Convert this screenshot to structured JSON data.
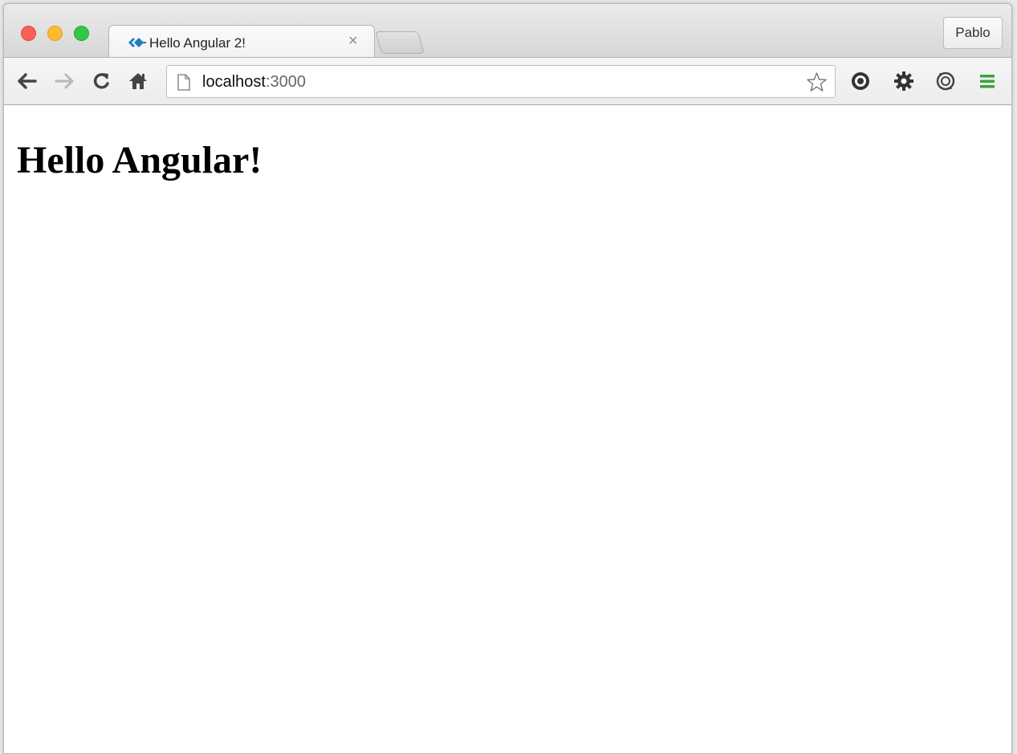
{
  "window": {
    "controls": [
      "close",
      "minimize",
      "zoom"
    ]
  },
  "tab": {
    "title": "Hello Angular 2!",
    "favicon": "angular-icon",
    "close_glyph": "×"
  },
  "profile": {
    "name": "Pablo"
  },
  "toolbar": {
    "icons": [
      "back-arrow-icon",
      "forward-arrow-icon",
      "reload-icon",
      "home-icon",
      "bookmark-star-icon",
      "extension-circle-icon",
      "extension-gear-icon",
      "extension-sync-icon",
      "menu-icon"
    ]
  },
  "address_bar": {
    "host": "localhost",
    "port": ":3000"
  },
  "page": {
    "heading": "Hello Angular!"
  },
  "colors": {
    "menu_icon": "#3ca23c",
    "favicon": "#1e7fc0"
  }
}
